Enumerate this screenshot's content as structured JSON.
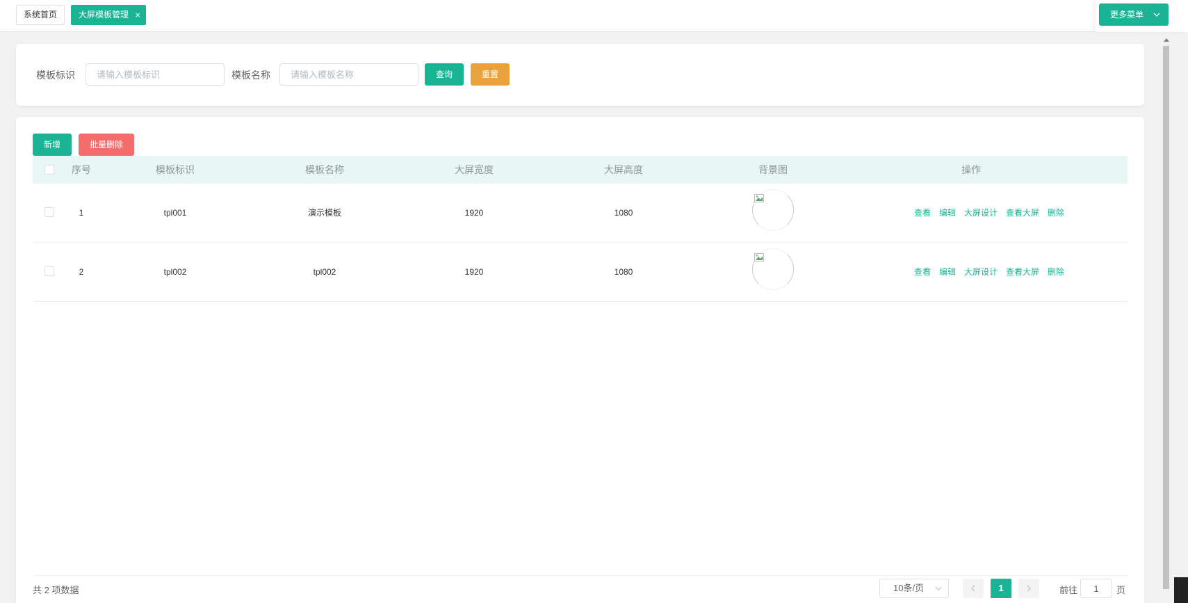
{
  "tabs": {
    "home_label": "系统首页",
    "active_label": "大屏模板管理",
    "close_glyph": "×"
  },
  "more_menu": {
    "label": "更多菜单",
    "chevron_icon": "chevron-down-icon"
  },
  "search": {
    "id_label": "模板标识",
    "id_placeholder": "请输入模板标识",
    "id_value": "",
    "name_label": "模板名称",
    "name_placeholder": "请输入模板名称",
    "name_value": "",
    "query_label": "查询",
    "reset_label": "重置"
  },
  "toolbar": {
    "add_label": "新增",
    "batch_delete_label": "批量删除"
  },
  "table": {
    "columns": [
      "序号",
      "模板标识",
      "模板名称",
      "大屏宽度",
      "大屏高度",
      "背景图",
      "操作"
    ],
    "rows": [
      {
        "index": "1",
        "template_id": "tpl001",
        "template_name": "演示模板",
        "width": "1920",
        "height": "1080"
      },
      {
        "index": "2",
        "template_id": "tpl002",
        "template_name": "tpl002",
        "width": "1920",
        "height": "1080"
      }
    ],
    "actions": [
      "查看",
      "编辑",
      "大屏设计",
      "查看大屏",
      "删除"
    ]
  },
  "pagination": {
    "total_text": "共 2 项数据",
    "page_size": "10条/页",
    "current_page": "1",
    "goto_label": "前往",
    "goto_value": "1",
    "page_suffix": "页"
  },
  "colors": {
    "primary": "#1ab394",
    "warning": "#e8a33c",
    "danger": "#f56c6c",
    "header_bg": "#e8f7f3"
  }
}
